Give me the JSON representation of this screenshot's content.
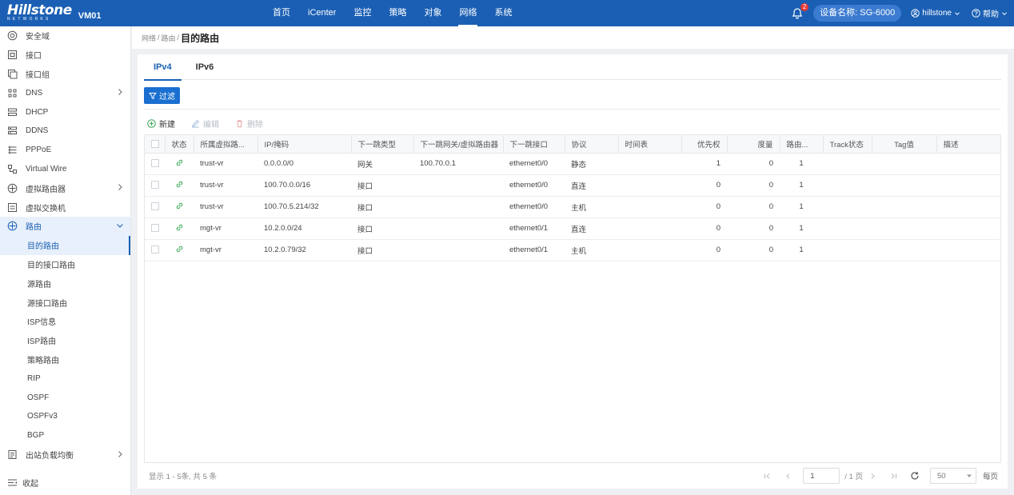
{
  "topbar": {
    "logo": "Hillstone",
    "logo_sub": "NETWORKS",
    "vm": "VM01",
    "nav": [
      "首页",
      "iCenter",
      "监控",
      "策略",
      "对象",
      "网络",
      "系统"
    ],
    "active_nav_index": 5,
    "notification_count": "2",
    "device_name": "设备名称: SG-6000",
    "user": "hillstone",
    "help": "帮助"
  },
  "sidebar": {
    "items": [
      {
        "label": "安全域",
        "icon": "shield-icon"
      },
      {
        "label": "接口",
        "icon": "interface-icon"
      },
      {
        "label": "接口组",
        "icon": "interface-group-icon"
      },
      {
        "label": "DNS",
        "icon": "dns-icon",
        "chevron": "right"
      },
      {
        "label": "DHCP",
        "icon": "dhcp-icon"
      },
      {
        "label": "DDNS",
        "icon": "ddns-icon"
      },
      {
        "label": "PPPoE",
        "icon": "pppoe-icon"
      },
      {
        "label": "Virtual Wire",
        "icon": "virtual-wire-icon"
      },
      {
        "label": "虚拟路由器",
        "icon": "virtual-router-icon",
        "chevron": "right"
      },
      {
        "label": "虚拟交换机",
        "icon": "virtual-switch-icon"
      },
      {
        "label": "路由",
        "icon": "route-icon",
        "chevron": "down"
      }
    ],
    "route_children": [
      "目的路由",
      "目的接口路由",
      "源路由",
      "源接口路由",
      "ISP信息",
      "ISP路由",
      "策略路由",
      "RIP",
      "OSPF",
      "OSPFv3",
      "BGP"
    ],
    "active_child_index": 0,
    "after_items": [
      {
        "label": "出站负载均衡",
        "icon": "outbound-lb-icon",
        "chevron": "right"
      }
    ],
    "collapse_label": "收起"
  },
  "breadcrumb": {
    "parts": [
      "网络",
      "路由"
    ],
    "current": "目的路由"
  },
  "tabs": [
    {
      "label": "IPv4"
    },
    {
      "label": "IPv6"
    }
  ],
  "active_tab_index": 0,
  "toolbar": {
    "filter_label": "过滤",
    "new_label": "新建",
    "edit_label": "编辑",
    "delete_label": "删除"
  },
  "table": {
    "columns": [
      "",
      "状态",
      "所属虚拟路...",
      "IP/掩码",
      "下一跳类型",
      "下一跳网关/虚拟路由器",
      "下一跳接口",
      "协议",
      "时间表",
      "优先权",
      "度量",
      "路由...",
      "Track状态",
      "Tag值",
      "描述"
    ],
    "rows": [
      {
        "vr": "trust-vr",
        "ip": "0.0.0.0/0",
        "next_type": "网关",
        "gateway": "100.70.0.1",
        "iface": "ethernet0/0",
        "protocol": "静态",
        "schedule": "",
        "priority": "1",
        "metric": "0",
        "route": "1",
        "track": "",
        "tag": "",
        "desc": ""
      },
      {
        "vr": "trust-vr",
        "ip": "100.70.0.0/16",
        "next_type": "接口",
        "gateway": "",
        "iface": "ethernet0/0",
        "protocol": "直连",
        "schedule": "",
        "priority": "0",
        "metric": "0",
        "route": "1",
        "track": "",
        "tag": "",
        "desc": ""
      },
      {
        "vr": "trust-vr",
        "ip": "100.70.5.214/32",
        "next_type": "接口",
        "gateway": "",
        "iface": "ethernet0/0",
        "protocol": "主机",
        "schedule": "",
        "priority": "0",
        "metric": "0",
        "route": "1",
        "track": "",
        "tag": "",
        "desc": ""
      },
      {
        "vr": "mgt-vr",
        "ip": "10.2.0.0/24",
        "next_type": "接口",
        "gateway": "",
        "iface": "ethernet0/1",
        "protocol": "直连",
        "schedule": "",
        "priority": "0",
        "metric": "0",
        "route": "1",
        "track": "",
        "tag": "",
        "desc": ""
      },
      {
        "vr": "mgt-vr",
        "ip": "10.2.0.79/32",
        "next_type": "接口",
        "gateway": "",
        "iface": "ethernet0/1",
        "protocol": "主机",
        "schedule": "",
        "priority": "0",
        "metric": "0",
        "route": "1",
        "track": "",
        "tag": "",
        "desc": ""
      }
    ]
  },
  "footer": {
    "summary": "显示 1 - 5条, 共 5 条",
    "page_value": "1",
    "page_total": "/ 1 页",
    "page_size": "50",
    "per_page_label": "每页"
  },
  "colors": {
    "brand": "#1a5fb4",
    "status_icon": "#3aa757"
  }
}
